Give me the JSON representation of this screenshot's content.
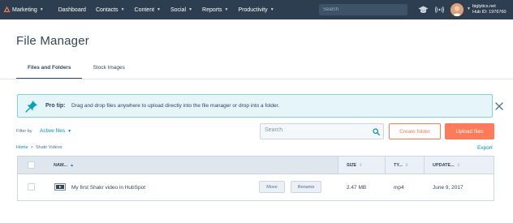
{
  "nav": {
    "brand": "Marketing",
    "items": [
      "Dashboard",
      "Contacts",
      "Content",
      "Social",
      "Reports",
      "Productivity"
    ],
    "search_placeholder": "Search",
    "account": {
      "domain": "biglytics.net",
      "hub_id": "Hub ID: 1976760"
    },
    "icons": [
      "sprocket-logo-icon",
      "graduation-cap-icon",
      "notifications-icon",
      "avatar",
      "chevron-down-icon"
    ]
  },
  "page": {
    "title": "File Manager"
  },
  "tabs": [
    {
      "label": "Files and Folders",
      "active": true
    },
    {
      "label": "Stock Images",
      "active": false
    }
  ],
  "tip": {
    "label": "Pro tip:",
    "text": "Drag and drop files anywhere to upload directly into the file manager or drop into a folder."
  },
  "filter": {
    "label": "Filter by",
    "value": "Active files"
  },
  "search": {
    "placeholder": "Search"
  },
  "buttons": {
    "create_folder": "Create folder",
    "upload_files": "Upload files",
    "export": "Export"
  },
  "breadcrumb": {
    "home": "Home",
    "separator": ">",
    "current": "Shakr Videos"
  },
  "table": {
    "columns": {
      "name": "NAM...",
      "size": "SIZE",
      "type": "TY...",
      "updated": "UPDATE..."
    },
    "rows": [
      {
        "name": "My first Shakr video in HubSpot",
        "move": "Move",
        "rename": "Rename",
        "size": "2.47 MB",
        "type": "mp4",
        "updated": "June 9, 2017"
      }
    ]
  },
  "colors": {
    "nav_bg": "#2d3e50",
    "accent_orange": "#ff7a59",
    "link_teal": "#0091ae",
    "tip_bg": "#e5f5f8",
    "tip_border": "#7fd1de",
    "text": "#33475b"
  }
}
